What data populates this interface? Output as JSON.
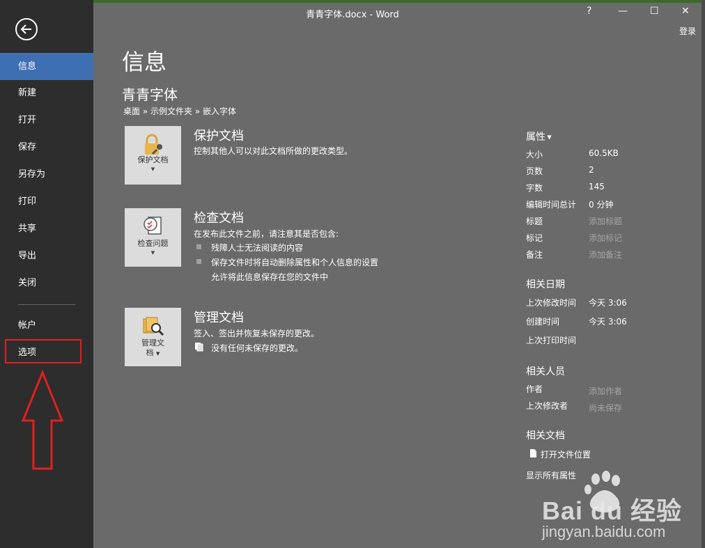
{
  "window": {
    "title": "青青字体.docx - Word",
    "help": "?",
    "minimize": "—",
    "maximize": "☐",
    "close": "✕",
    "signin": "登录"
  },
  "sidebar": {
    "items": [
      {
        "label": "信息"
      },
      {
        "label": "新建"
      },
      {
        "label": "打开"
      },
      {
        "label": "保存"
      },
      {
        "label": "另存为"
      },
      {
        "label": "打印"
      },
      {
        "label": "共享"
      },
      {
        "label": "导出"
      },
      {
        "label": "关闭"
      },
      {
        "label": "帐户"
      },
      {
        "label": "选项"
      }
    ]
  },
  "main": {
    "title": "信息",
    "doc_name": "青青字体",
    "breadcrumb": "桌面 » 示例文件夹 » 嵌入字体",
    "protect": {
      "button": "保护文档",
      "title": "保护文档",
      "desc": "控制其他人可以对此文档所做的更改类型。"
    },
    "inspect": {
      "button": "检查问题",
      "title": "检查文档",
      "desc": "在发布此文件之前，请注意其是否包含:",
      "bullets": [
        "残障人士无法阅读的内容",
        "保存文件时将自动删除属性和个人信息的设置"
      ],
      "allow": "允许将此信息保存在您的文件中"
    },
    "manage": {
      "button_line1": "管理文",
      "button_line2": "档",
      "title": "管理文档",
      "desc": "签入、签出并恢复未保存的更改。",
      "status": "没有任何未保存的更改。"
    }
  },
  "properties": {
    "heading": "属性",
    "rows": [
      {
        "label": "大小",
        "value": "60.5KB"
      },
      {
        "label": "页数",
        "value": "2"
      },
      {
        "label": "字数",
        "value": "145"
      },
      {
        "label": "编辑时间总计",
        "value": "0 分钟"
      },
      {
        "label": "标题",
        "value": "添加标题"
      },
      {
        "label": "标记",
        "value": "添加标记"
      },
      {
        "label": "备注",
        "value": "添加备注"
      }
    ],
    "dates_heading": "相关日期",
    "dates": [
      {
        "label": "上次修改时间",
        "value": "今天 3:06"
      },
      {
        "label": "创建时间",
        "value": "今天 3:06"
      },
      {
        "label": "上次打印时间",
        "value": ""
      }
    ],
    "people_heading": "相关人员",
    "people": [
      {
        "label": "作者",
        "value": "添加作者"
      },
      {
        "label": "上次修改者",
        "value": "尚未保存"
      }
    ],
    "docs_heading": "相关文档",
    "open_location": "打开文件位置",
    "show_all": "显示所有属性"
  },
  "watermark": {
    "brand": "Bai du 经验",
    "url": "jingyan.baidu.com"
  },
  "colors": {
    "sidebar": "#2d2d2d",
    "active": "#3e6fb3",
    "main_bg": "#6a6a6a",
    "highlight": "#e02020"
  }
}
